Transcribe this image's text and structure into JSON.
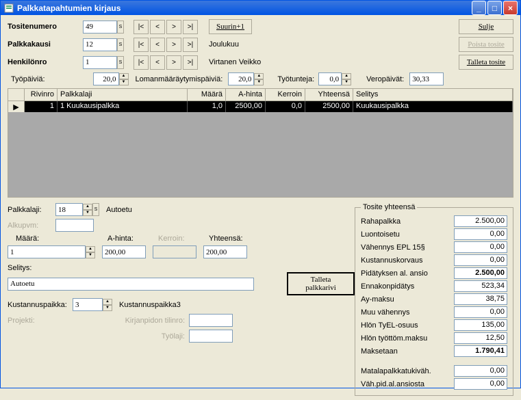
{
  "title": "Palkkatapahtumien kirjaus",
  "buttons": {
    "close": "Sulje",
    "delete": "Poista tosite",
    "save_voucher": "Talleta tosite",
    "biggest": "Suurin+1",
    "save_row": "Talleta palkkarivi"
  },
  "labels": {
    "voucher": "Tositenumero",
    "period": "Palkkakausi",
    "person": "Henkilönro",
    "workdays": "Työpäiviä:",
    "holiday_basis": "Lomanmääräytymispäiviä:",
    "workhours": "Työtunteja:",
    "taxdays": "Veropäivät:",
    "month": "Joulukuu",
    "person_name": "Virtanen Veikko",
    "salarytype": "Palkkalaji:",
    "salarytype_name": "Autoetu",
    "startdate": "Alkupvm:",
    "qty": "Määrä:",
    "unitprice": "A-hinta:",
    "coeff": "Kerroin:",
    "total": "Yhteensä:",
    "desc": "Selitys:",
    "costcenter": "Kustannuspaikka:",
    "costcenter_name": "Kustannuspaikka3",
    "project": "Projekti:",
    "account": "Kirjanpidon tilinro:",
    "job": "Työlaji:"
  },
  "fields": {
    "voucher": "49",
    "period": "12",
    "person": "1",
    "workdays": "20,0",
    "holiday_basis": "20,0",
    "workhours": "0,0",
    "taxdays": "30,33",
    "salarytype": "18",
    "qty": "1",
    "unitprice": "200,00",
    "coeff": "",
    "total": "200,00",
    "desc": "Autoetu",
    "costcenter": "3",
    "account": "",
    "job": ""
  },
  "grid": {
    "headers": {
      "rowno": "Rivinro",
      "type": "Palkkalaji",
      "qty": "Määrä",
      "price": "A-hinta",
      "coeff": "Kerroin",
      "total": "Yhteensä",
      "desc": "Selitys"
    },
    "rows": [
      {
        "rowno": "1",
        "type": "1 Kuukausipalkka",
        "qty": "1,0",
        "price": "2500,00",
        "coeff": "0,0",
        "total": "2500,00",
        "desc": "Kuukausipalkka"
      }
    ]
  },
  "totals": {
    "legend": "Tosite yhteensä",
    "items": [
      {
        "label": "Rahapalkka",
        "value": "2.500,00",
        "bold": false
      },
      {
        "label": "Luontoisetu",
        "value": "0,00",
        "bold": false
      },
      {
        "label": "Vähennys EPL 15§",
        "value": "0,00",
        "bold": false
      },
      {
        "label": "Kustannuskorvaus",
        "value": "0,00",
        "bold": false
      },
      {
        "label": "Pidätyksen al. ansio",
        "value": "2.500,00",
        "bold": true
      },
      {
        "label": "Ennakonpidätys",
        "value": "523,34",
        "bold": false
      },
      {
        "label": "Ay-maksu",
        "value": "38,75",
        "bold": false
      },
      {
        "label": "Muu vähennys",
        "value": "0,00",
        "bold": false
      },
      {
        "label": "Hlön TyEL-osuus",
        "value": "135,00",
        "bold": false
      },
      {
        "label": "Hlön työttöm.maksu",
        "value": "12,50",
        "bold": false
      },
      {
        "label": "Maksetaan",
        "value": "1.790,41",
        "bold": true
      }
    ],
    "extra": [
      {
        "label": "Matalapalkkatukiväh.",
        "value": "0,00"
      },
      {
        "label": "Väh.pid.al.ansiosta",
        "value": "0,00"
      }
    ]
  },
  "nav": {
    "first": "|<",
    "prev": "<",
    "next": ">",
    "last": ">|"
  }
}
